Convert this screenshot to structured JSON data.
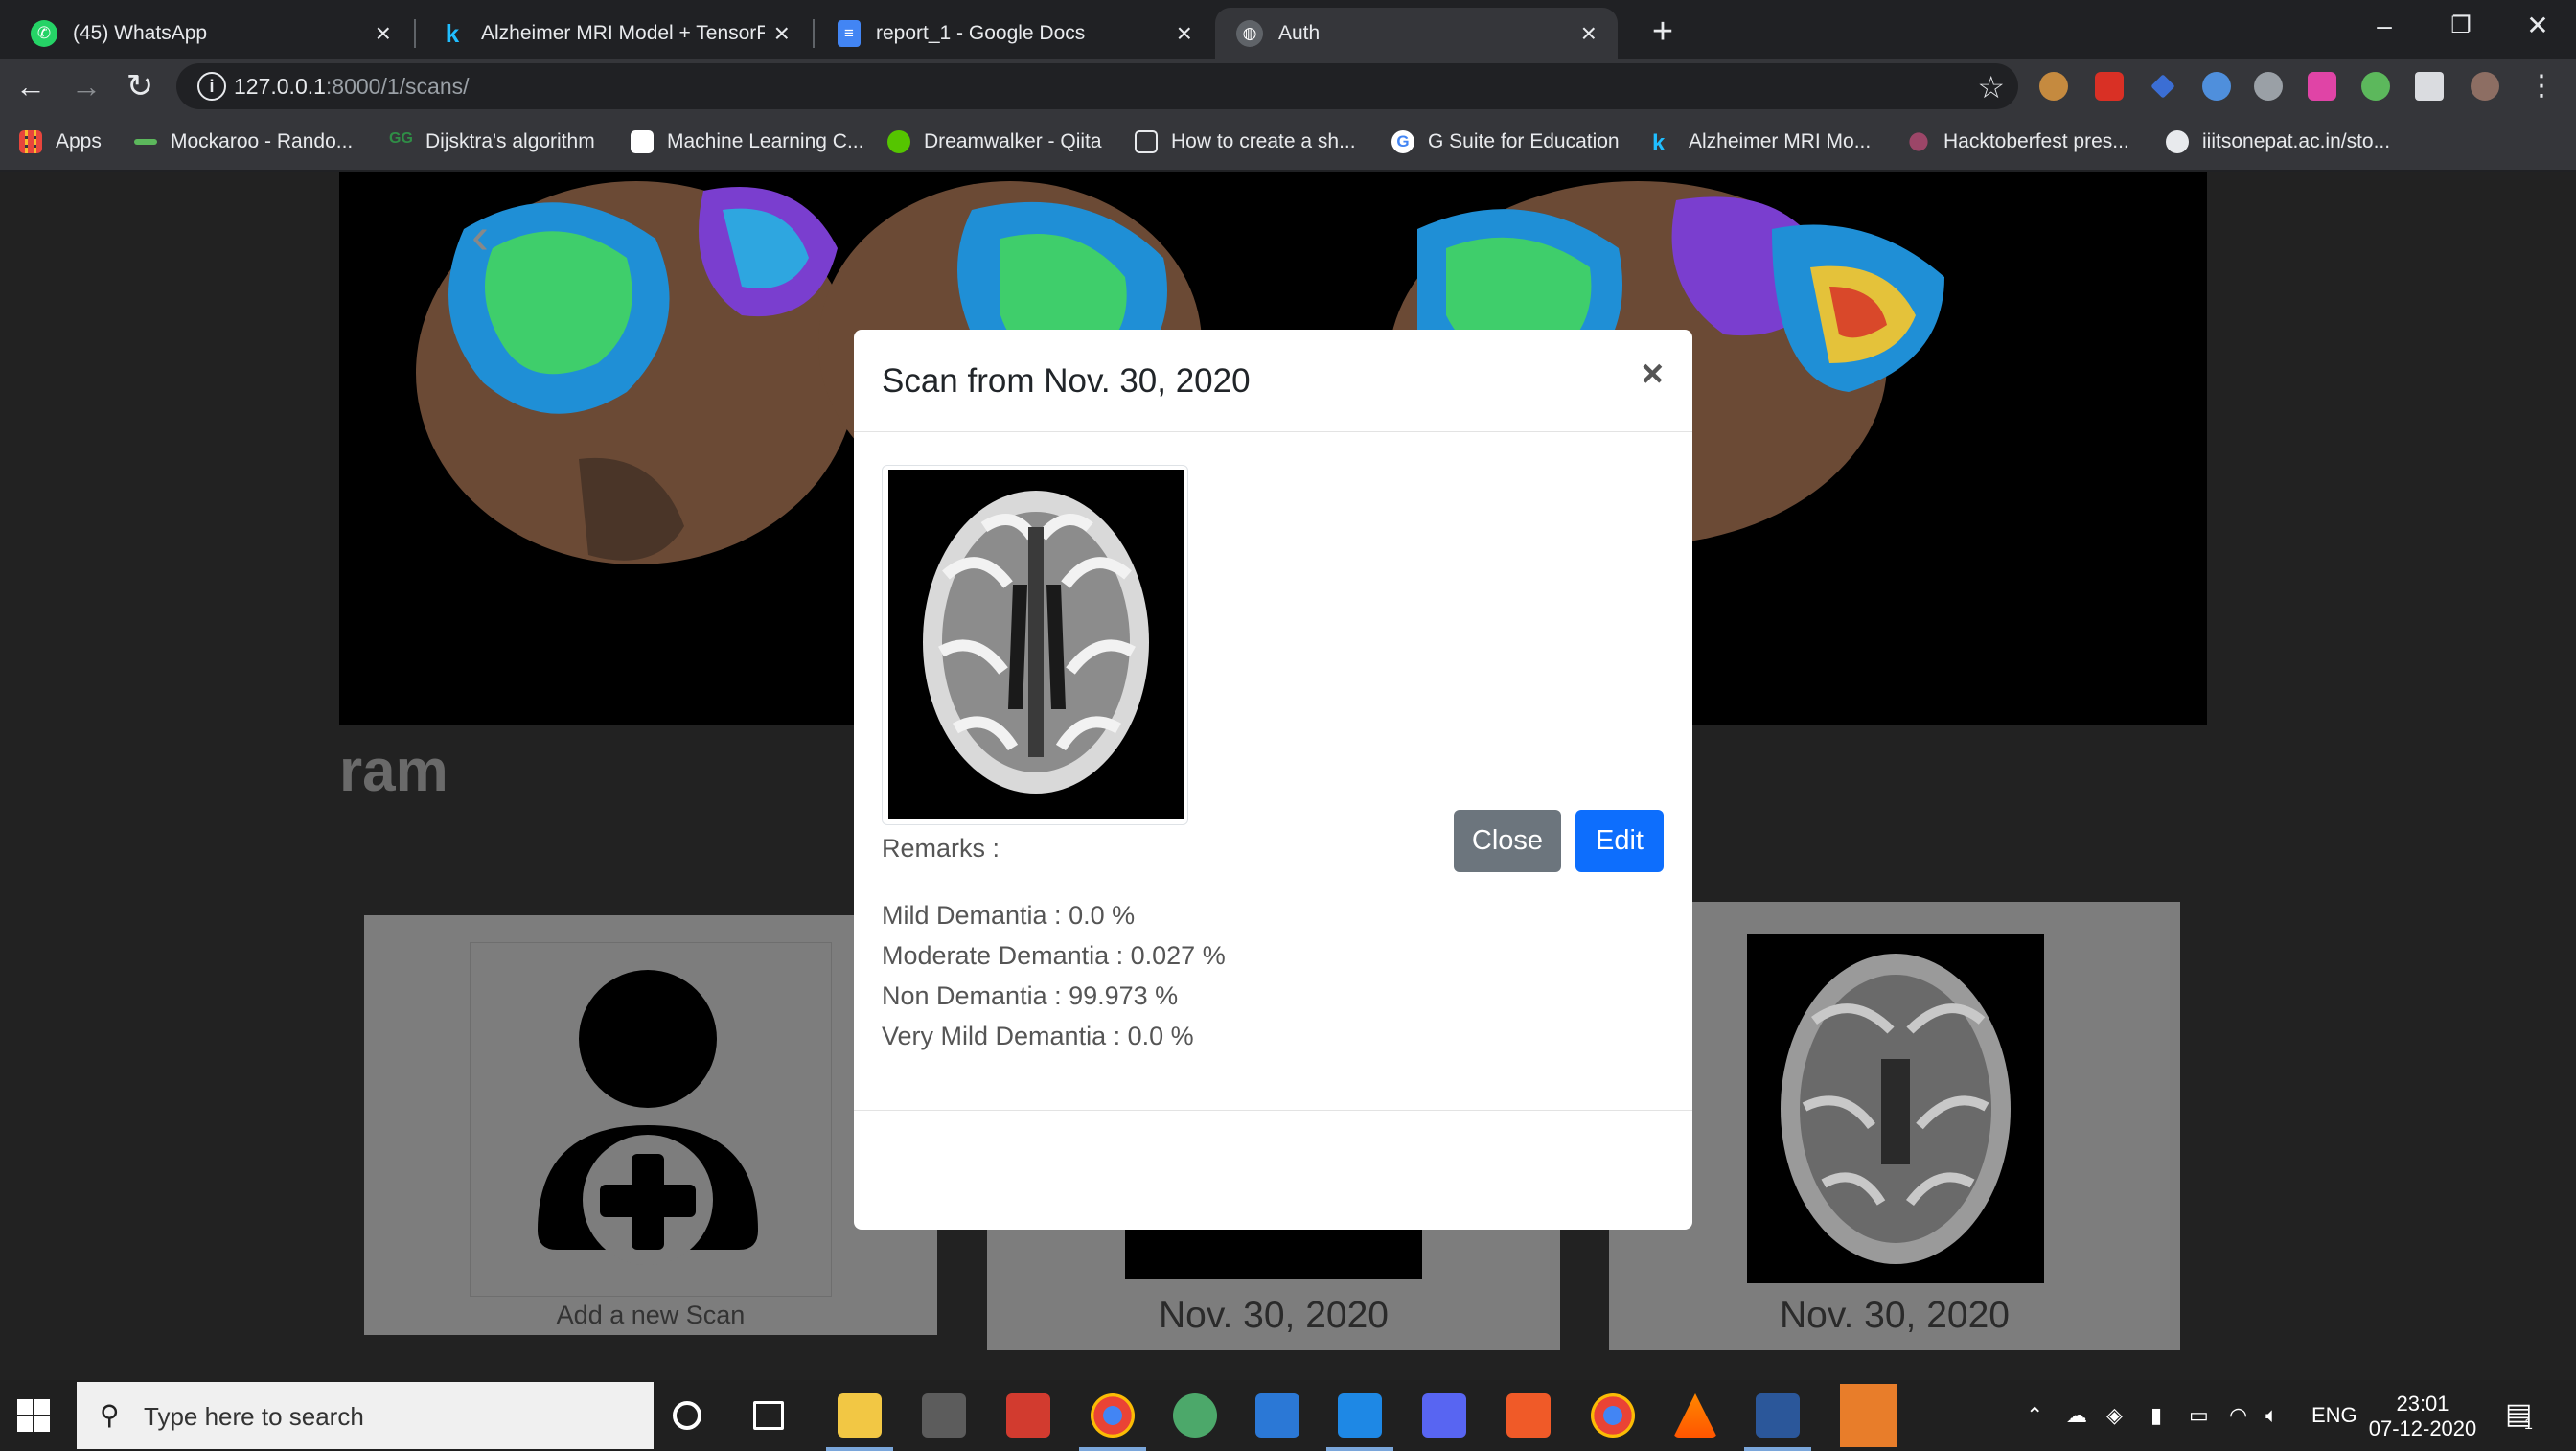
{
  "browser": {
    "tabs": [
      {
        "title": "(45) WhatsApp",
        "icon": "whatsapp-icon",
        "active": false
      },
      {
        "title": "Alzheimer MRI Model + TensorFl",
        "icon": "kaggle-icon",
        "active": false
      },
      {
        "title": "report_1 - Google Docs",
        "icon": "google-docs-icon",
        "active": false
      },
      {
        "title": "Auth",
        "icon": "globe-icon",
        "active": true
      }
    ],
    "url_host": "127.0.0.1",
    "url_path": ":8000/1/scans/",
    "bookmarks": [
      "Apps",
      "Mockaroo - Rando...",
      "Dijsktra's algorithm",
      "Machine Learning C...",
      "Dreamwalker - Qiita",
      "How to create a sh...",
      "G Suite for Education",
      "Alzheimer MRI Mo...",
      "Hacktoberfest pres...",
      "iiitsonepat.ac.in/sto..."
    ]
  },
  "page": {
    "patient_name": "ram",
    "cards": [
      {
        "label": "Add a new Scan"
      },
      {
        "label": "Nov. 30, 2020"
      },
      {
        "label": "Nov. 30, 2020"
      }
    ]
  },
  "modal": {
    "title": "Scan from Nov. 30, 2020",
    "remarks_label": "Remarks :",
    "results": [
      "Mild Demantia : 0.0 %",
      "Moderate Demantia : 0.027 %",
      "Non Demantia : 99.973 %",
      "Very Mild Demantia : 0.0 %"
    ],
    "close_label": "Close",
    "edit_label": "Edit"
  },
  "taskbar": {
    "search_placeholder": "Type here to search",
    "language": "ENG",
    "time": "23:01",
    "date": "07-12-2020",
    "notification_count": "1"
  },
  "colors": {
    "accent_blue": "#0d6efd",
    "secondary_gray": "#6c757d",
    "chrome_dark": "#202124",
    "chrome_toolbar": "#35363a"
  }
}
